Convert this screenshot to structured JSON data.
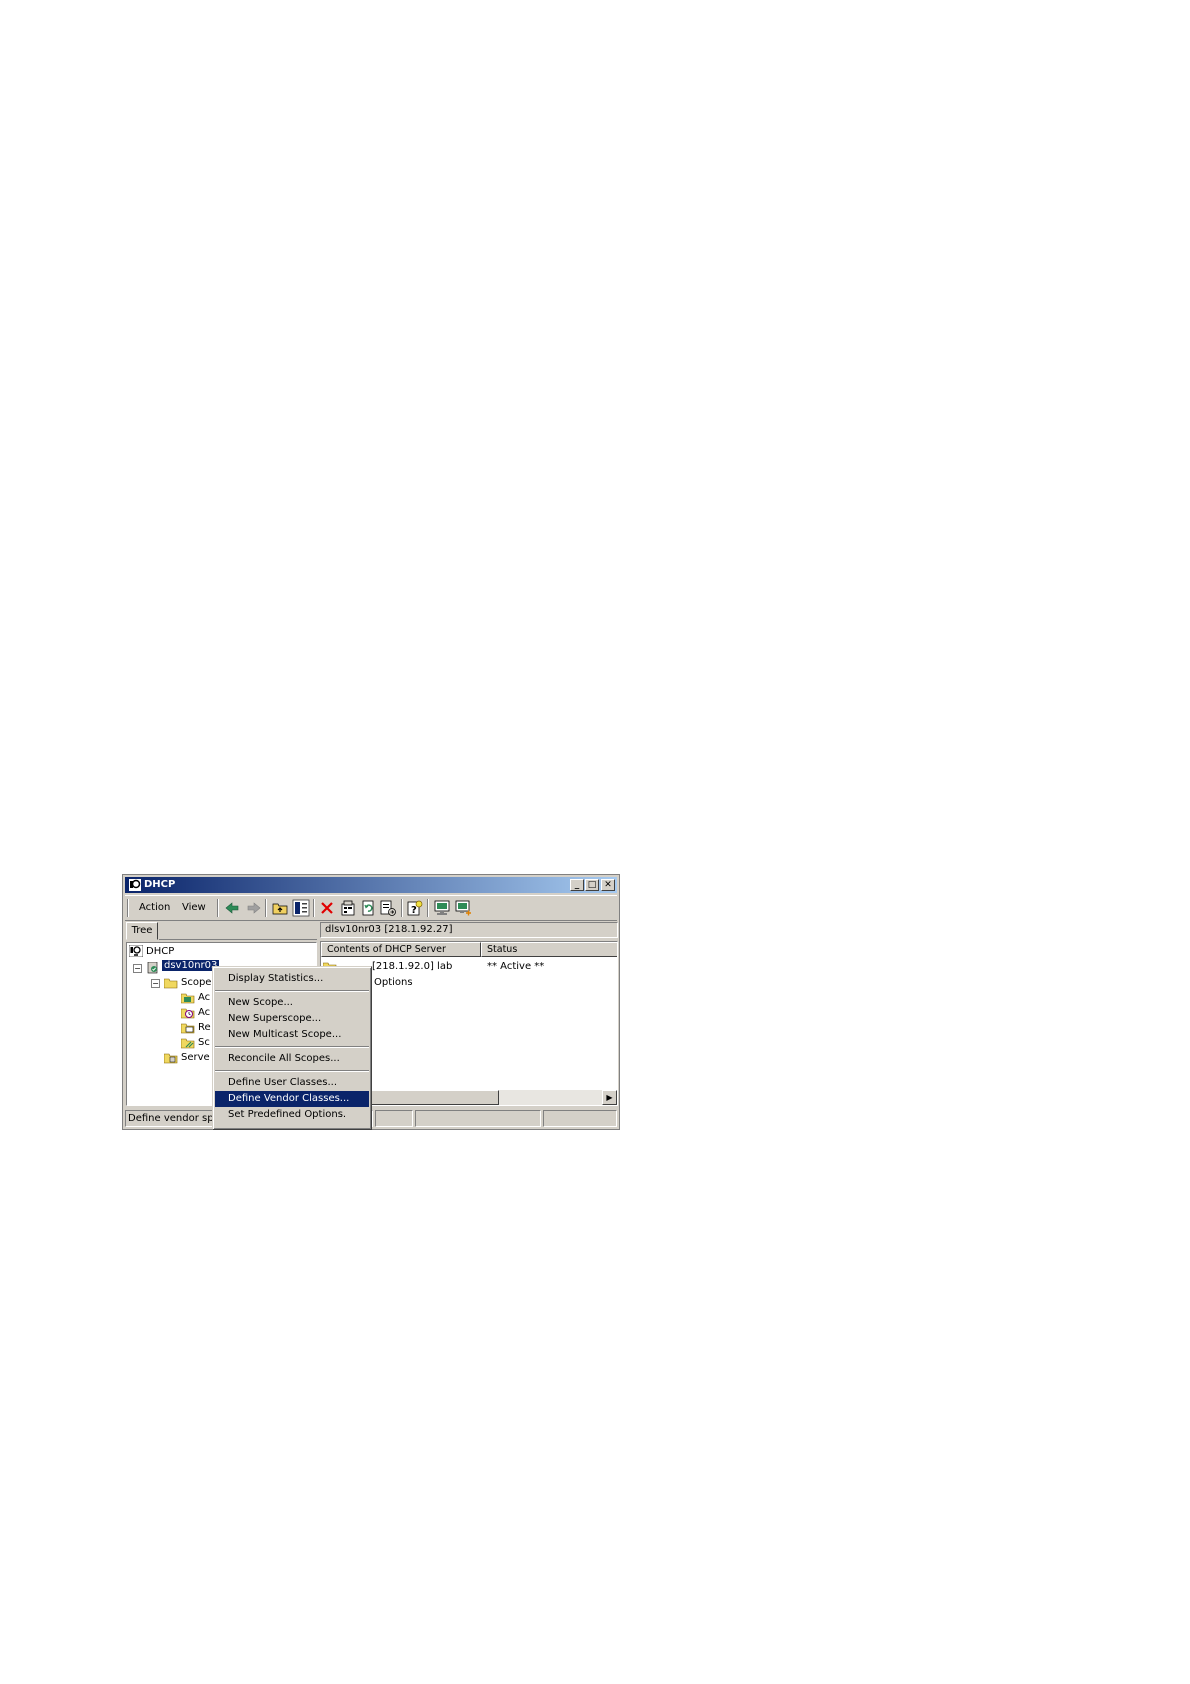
{
  "window": {
    "title": "DHCP",
    "accent_color": "#0a246a",
    "caption_buttons": [
      "minimize",
      "maximize",
      "close"
    ]
  },
  "menu": {
    "action": "Action",
    "view": "View"
  },
  "toolbar_icons": [
    "back-icon",
    "forward-icon",
    "up-folder-icon",
    "show-hide-tree-icon",
    "delete-icon",
    "properties-icon",
    "refresh-icon",
    "export-list-icon",
    "help-icon",
    "server-icon",
    "add-server-icon"
  ],
  "tree": {
    "tab_label": "Tree",
    "root": "DHCP",
    "server": "dsv10nr03",
    "children": [
      "Scope",
      "Ac",
      "Ac",
      "Re",
      "Sc",
      "Serve"
    ]
  },
  "content": {
    "header": "dlsv10nr03 [218.1.92.27]",
    "columns": [
      "Contents of DHCP Server",
      "Status"
    ],
    "rows": [
      {
        "name": "[218.1.92.0] lab",
        "status": "** Active **"
      },
      {
        "name": "Options",
        "status": ""
      }
    ]
  },
  "context_menu": {
    "items": [
      "Display Statistics...",
      "New Scope...",
      "New Superscope...",
      "New Multicast Scope...",
      "Reconcile All Scopes...",
      "Define User Classes...",
      "Define Vendor Classes...",
      "Set Predefined Options."
    ],
    "highlighted": "Define Vendor Classes..."
  },
  "statusbar": {
    "text": "Define vendor spe"
  }
}
